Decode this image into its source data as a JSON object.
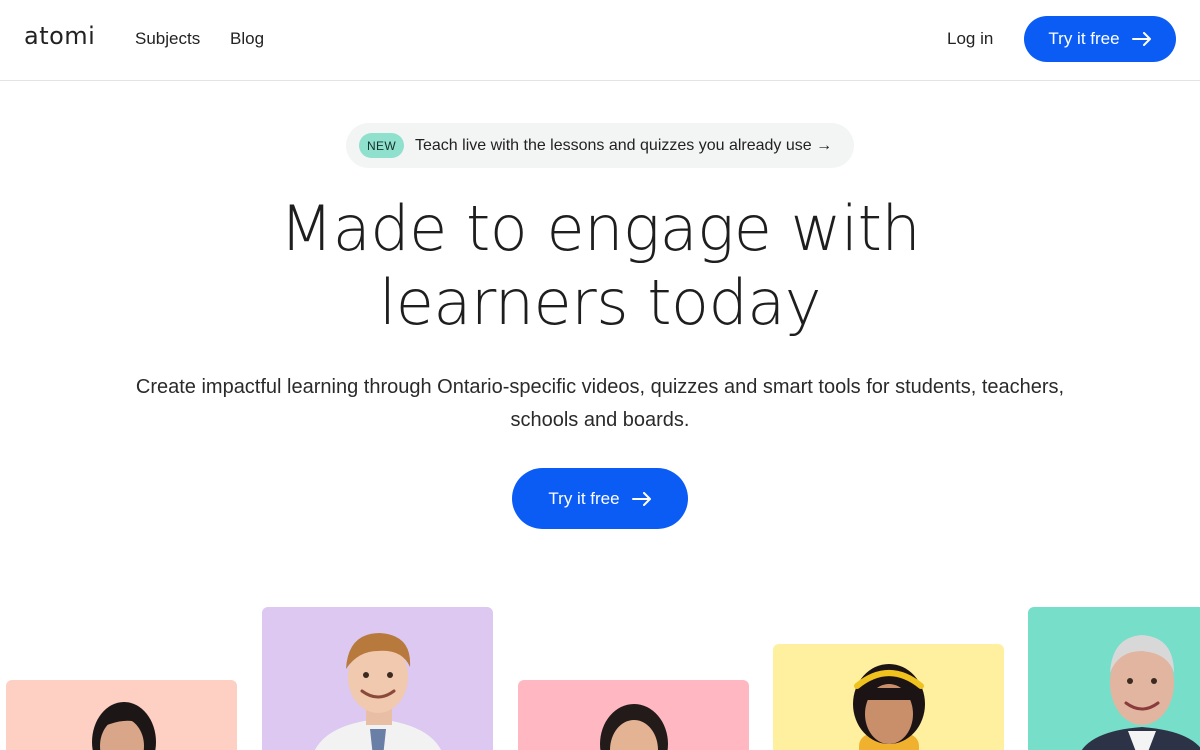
{
  "header": {
    "logo": "atomi",
    "nav": {
      "subjects": "Subjects",
      "blog": "Blog"
    },
    "login": "Log in",
    "cta": "Try it free"
  },
  "announcement": {
    "badge": "NEW",
    "text": "Teach live with the lessons and quizzes you already use →"
  },
  "hero": {
    "title_line1": "Made to engage with",
    "title_line2": "learners today",
    "subtitle_line1": "Create impactful learning through Ontario-specific videos, quizzes and smart tools for students, teachers,",
    "subtitle_line2": "schools and boards.",
    "cta": "Try it free"
  },
  "colors": {
    "accent": "#0a5cf5",
    "badge": "#8fe0cd",
    "card_peach": "#fdd0c3",
    "card_lavender": "#dcc8f1",
    "card_pink": "#ffb8c2",
    "card_yellow": "#fff0a0",
    "card_teal": "#77dec9"
  },
  "people_cards": [
    {
      "icon": "person-photo-woman-dark-hair"
    },
    {
      "icon": "person-photo-teen-boy"
    },
    {
      "icon": "person-photo-woman-smiling"
    },
    {
      "icon": "person-photo-girl-headband"
    },
    {
      "icon": "person-photo-older-man"
    }
  ]
}
